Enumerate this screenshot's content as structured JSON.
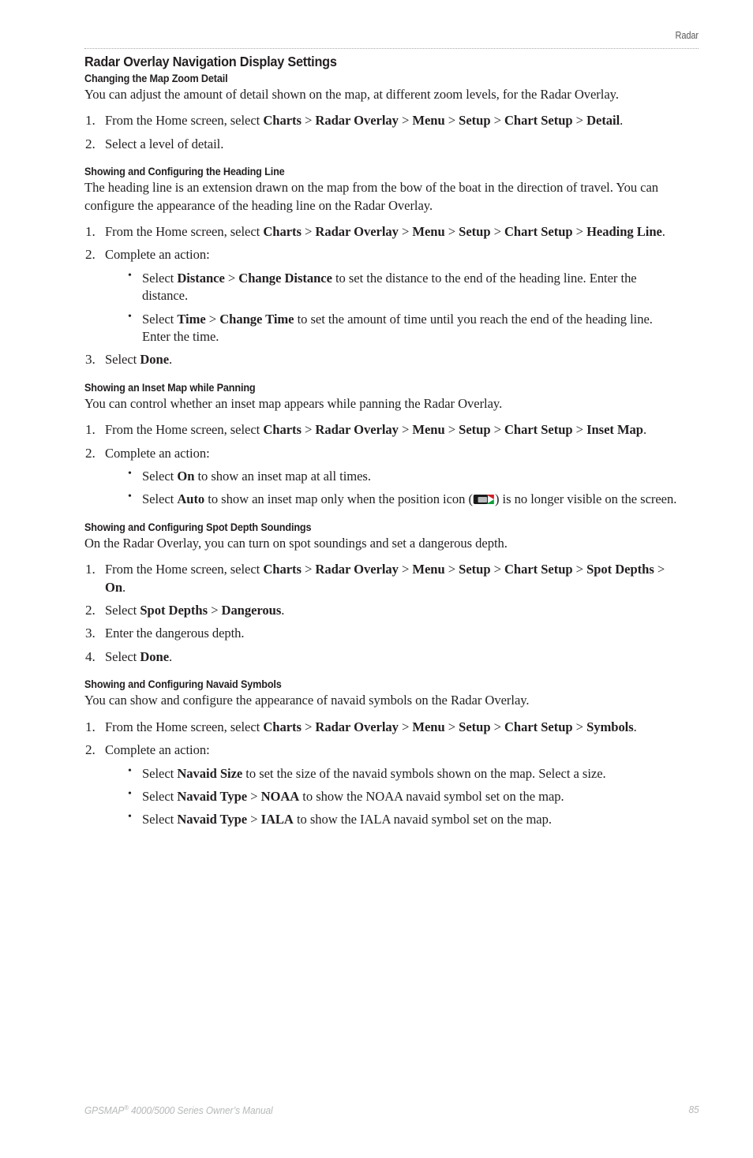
{
  "header": {
    "running_head": "Radar"
  },
  "page_title": "Radar Overlay Navigation Display Settings",
  "sections": [
    {
      "heading": "Changing the Map Zoom Detail",
      "intro": "You can adjust the amount of detail shown on the map, at different zoom levels, for the Radar Overlay.",
      "steps": [
        "From the Home screen, select Charts > Radar Overlay > Menu > Setup > Chart Setup > Detail.",
        "Select a level of detail."
      ],
      "bullets": []
    },
    {
      "heading": "Showing and Configuring the Heading Line",
      "intro": "The heading line is an extension drawn on the map from the bow of the boat in the direction of travel. You can configure the appearance of the heading line on the Radar Overlay.",
      "steps": [
        "From the Home screen, select Charts > Radar Overlay > Menu > Setup > Chart Setup > Heading Line.",
        "Complete an action:",
        "Select Done."
      ],
      "bullets": [
        "Select Distance > Change Distance to set the distance to the end of the heading line. Enter the distance.",
        "Select Time > Change Time to set the amount of time until you reach the end of the heading line. Enter the time."
      ]
    },
    {
      "heading": "Showing an Inset Map while Panning",
      "intro": "You can control whether an inset map appears while panning the Radar Overlay.",
      "steps": [
        "From the Home screen, select Charts > Radar Overlay > Menu > Setup > Chart Setup > Inset Map.",
        "Complete an action:"
      ],
      "bullets": [
        "Select On to show an inset map at all times.",
        "Select Auto to show an inset map only when the position icon ( ) is no longer visible on the screen."
      ],
      "inline_icon": "boat-position-icon"
    },
    {
      "heading": "Showing and Configuring Spot Depth Soundings",
      "intro": "On the Radar Overlay, you can turn on spot soundings and set a dangerous depth.",
      "steps": [
        "From the Home screen, select Charts > Radar Overlay > Menu > Setup > Chart Setup > Spot Depths > On.",
        "Select Spot Depths > Dangerous.",
        "Enter the dangerous depth.",
        "Select Done."
      ],
      "bullets": []
    },
    {
      "heading": "Showing and Configuring Navaid Symbols",
      "intro": "You can show and configure the appearance of navaid symbols on the Radar Overlay.",
      "steps": [
        "From the Home screen, select Charts > Radar Overlay > Menu > Setup > Chart Setup > Symbols.",
        "Complete an action:"
      ],
      "bullets": [
        "Select Navaid Size to set the size of the navaid symbols shown on the map. Select a size.",
        "Select Navaid Type > NOAA to show the NOAA navaid symbol set on the map.",
        "Select Navaid Type > IALA to show the IALA navaid symbol set on the map."
      ]
    }
  ],
  "text_runs": {
    "s1_step1": [
      {
        "t": "From the Home screen, select ",
        "b": false
      },
      {
        "t": "Charts",
        "b": true
      },
      {
        "t": " > ",
        "b": false
      },
      {
        "t": "Radar Overlay",
        "b": true
      },
      {
        "t": " > ",
        "b": false
      },
      {
        "t": "Menu",
        "b": true
      },
      {
        "t": " > ",
        "b": false
      },
      {
        "t": "Setup",
        "b": true
      },
      {
        "t": " > ",
        "b": false
      },
      {
        "t": "Chart Setup",
        "b": true
      },
      {
        "t": " > ",
        "b": false
      },
      {
        "t": "Detail",
        "b": true
      },
      {
        "t": ".",
        "b": false
      }
    ],
    "s1_step2": [
      {
        "t": "Select a level of detail.",
        "b": false
      }
    ],
    "s2_step1": [
      {
        "t": "From the Home screen, select ",
        "b": false
      },
      {
        "t": "Charts",
        "b": true
      },
      {
        "t": " > ",
        "b": false
      },
      {
        "t": "Radar Overlay",
        "b": true
      },
      {
        "t": " > ",
        "b": false
      },
      {
        "t": "Menu",
        "b": true
      },
      {
        "t": " > ",
        "b": false
      },
      {
        "t": "Setup",
        "b": true
      },
      {
        "t": " > ",
        "b": false
      },
      {
        "t": "Chart Setup",
        "b": true
      },
      {
        "t": " > ",
        "b": false
      },
      {
        "t": "Heading Line",
        "b": true
      },
      {
        "t": ".",
        "b": false
      }
    ],
    "s2_step2": [
      {
        "t": "Complete an action:",
        "b": false
      }
    ],
    "s2_step3": [
      {
        "t": "Select ",
        "b": false
      },
      {
        "t": "Done",
        "b": true
      },
      {
        "t": ".",
        "b": false
      }
    ],
    "s2_b1": [
      {
        "t": "Select ",
        "b": false
      },
      {
        "t": "Distance",
        "b": true
      },
      {
        "t": " > ",
        "b": false
      },
      {
        "t": "Change Distance",
        "b": true
      },
      {
        "t": " to set the distance to the end of the heading line. Enter the distance.",
        "b": false
      }
    ],
    "s2_b2": [
      {
        "t": "Select ",
        "b": false
      },
      {
        "t": "Time",
        "b": true
      },
      {
        "t": " > ",
        "b": false
      },
      {
        "t": "Change Time",
        "b": true
      },
      {
        "t": " to set the amount of time until you reach the end of the heading line. Enter the time.",
        "b": false
      }
    ],
    "s3_step1": [
      {
        "t": "From the Home screen, select ",
        "b": false
      },
      {
        "t": "Charts",
        "b": true
      },
      {
        "t": " > ",
        "b": false
      },
      {
        "t": "Radar Overlay",
        "b": true
      },
      {
        "t": " > ",
        "b": false
      },
      {
        "t": "Menu",
        "b": true
      },
      {
        "t": " > ",
        "b": false
      },
      {
        "t": "Setup",
        "b": true
      },
      {
        "t": " > ",
        "b": false
      },
      {
        "t": "Chart Setup",
        "b": true
      },
      {
        "t": " > ",
        "b": false
      },
      {
        "t": "Inset Map",
        "b": true
      },
      {
        "t": ".",
        "b": false
      }
    ],
    "s3_step2": [
      {
        "t": "Complete an action:",
        "b": false
      }
    ],
    "s3_b1": [
      {
        "t": "Select ",
        "b": false
      },
      {
        "t": "On",
        "b": true
      },
      {
        "t": " to show an inset map at all times.",
        "b": false
      }
    ],
    "s3_b2_pre": [
      {
        "t": "Select ",
        "b": false
      },
      {
        "t": "Auto",
        "b": true
      },
      {
        "t": " to show an inset map only when the position icon (",
        "b": false
      }
    ],
    "s3_b2_post": [
      {
        "t": ") is no longer visible on the screen.",
        "b": false
      }
    ],
    "s4_step1": [
      {
        "t": "From the Home screen, select ",
        "b": false
      },
      {
        "t": "Charts",
        "b": true
      },
      {
        "t": " > ",
        "b": false
      },
      {
        "t": "Radar Overlay",
        "b": true
      },
      {
        "t": " > ",
        "b": false
      },
      {
        "t": "Menu",
        "b": true
      },
      {
        "t": " > ",
        "b": false
      },
      {
        "t": "Setup",
        "b": true
      },
      {
        "t": " > ",
        "b": false
      },
      {
        "t": "Chart Setup",
        "b": true
      },
      {
        "t": " > ",
        "b": false
      },
      {
        "t": "Spot Depths",
        "b": true
      },
      {
        "t": " > ",
        "b": false
      },
      {
        "t": "On",
        "b": true
      },
      {
        "t": ".",
        "b": false
      }
    ],
    "s4_step2": [
      {
        "t": "Select ",
        "b": false
      },
      {
        "t": "Spot Depths",
        "b": true
      },
      {
        "t": " > ",
        "b": false
      },
      {
        "t": "Dangerous",
        "b": true
      },
      {
        "t": ".",
        "b": false
      }
    ],
    "s4_step3": [
      {
        "t": "Enter the dangerous depth.",
        "b": false
      }
    ],
    "s4_step4": [
      {
        "t": "Select ",
        "b": false
      },
      {
        "t": "Done",
        "b": true
      },
      {
        "t": ".",
        "b": false
      }
    ],
    "s5_step1": [
      {
        "t": "From the Home screen, select ",
        "b": false
      },
      {
        "t": "Charts",
        "b": true
      },
      {
        "t": " > ",
        "b": false
      },
      {
        "t": "Radar Overlay",
        "b": true
      },
      {
        "t": " > ",
        "b": false
      },
      {
        "t": "Menu",
        "b": true
      },
      {
        "t": " > ",
        "b": false
      },
      {
        "t": "Setup",
        "b": true
      },
      {
        "t": " > ",
        "b": false
      },
      {
        "t": "Chart Setup",
        "b": true
      },
      {
        "t": " > ",
        "b": false
      },
      {
        "t": "Symbols",
        "b": true
      },
      {
        "t": ".",
        "b": false
      }
    ],
    "s5_step2": [
      {
        "t": "Complete an action:",
        "b": false
      }
    ],
    "s5_b1": [
      {
        "t": "Select ",
        "b": false
      },
      {
        "t": "Navaid Size",
        "b": true
      },
      {
        "t": " to set the size of the navaid symbols shown on the map. Select a size.",
        "b": false
      }
    ],
    "s5_b2": [
      {
        "t": "Select ",
        "b": false
      },
      {
        "t": "Navaid Type",
        "b": true
      },
      {
        "t": " > ",
        "b": false
      },
      {
        "t": "NOAA",
        "b": true
      },
      {
        "t": " to show the NOAA navaid symbol set on the map.",
        "b": false
      }
    ],
    "s5_b3": [
      {
        "t": "Select ",
        "b": false
      },
      {
        "t": "Navaid Type",
        "b": true
      },
      {
        "t": " > ",
        "b": false
      },
      {
        "t": "IALA",
        "b": true
      },
      {
        "t": " to show the IALA navaid symbol set on the map.",
        "b": false
      }
    ]
  },
  "footer": {
    "manual_name": "GPSMAP",
    "registered_mark": "®",
    "manual_suffix": " 4000/5000 Series Owner’s Manual",
    "page_number": "85"
  },
  "colors": {
    "text": "#231f20",
    "header_gray": "#58595b",
    "rule_gray": "#a7a9ac",
    "footer_gray": "#b6b8ba",
    "icon_hull": "#1a1a1a",
    "icon_deck": "#b9bbbd",
    "icon_port_red": "#cf2027",
    "icon_starboard_green": "#0f9d3a"
  }
}
